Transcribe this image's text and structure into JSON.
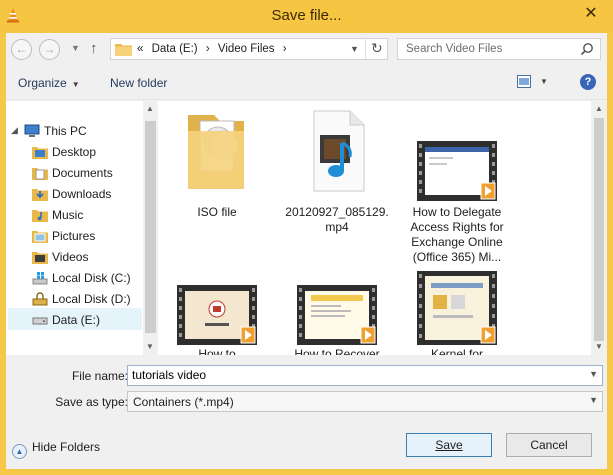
{
  "window": {
    "title": "Save file..."
  },
  "colors": {
    "accent_frame": "#f6c642",
    "selection": "#e5f3fb",
    "default_button_border": "#3c7fb1"
  },
  "nav": {
    "back_icon": "back-arrow-icon",
    "forward_icon": "forward-arrow-icon",
    "recent_icon": "chevron-down-icon",
    "up_icon": "up-arrow-icon",
    "breadcrumb_prefix": "«",
    "breadcrumbs": [
      "Data (E:)",
      "Video Files"
    ],
    "breadcrumb_sep": "›",
    "refresh_icon": "refresh-icon",
    "search_placeholder": "Search Video Files"
  },
  "toolbar": {
    "organize_label": "Organize",
    "new_folder_label": "New folder",
    "view_icon": "view-options-icon",
    "help_label": "?"
  },
  "sidebar": {
    "items": [
      {
        "label": "This PC",
        "icon": "computer-icon"
      },
      {
        "label": "Desktop",
        "icon": "desktop-folder-icon"
      },
      {
        "label": "Documents",
        "icon": "documents-folder-icon"
      },
      {
        "label": "Downloads",
        "icon": "downloads-folder-icon"
      },
      {
        "label": "Music",
        "icon": "music-folder-icon"
      },
      {
        "label": "Pictures",
        "icon": "pictures-folder-icon"
      },
      {
        "label": "Videos",
        "icon": "videos-folder-icon"
      },
      {
        "label": "Local Disk (C:)",
        "icon": "windows-drive-icon"
      },
      {
        "label": "Local Disk (D:)",
        "icon": "locked-drive-icon"
      },
      {
        "label": "Data (E:)",
        "icon": "drive-icon"
      }
    ],
    "selected_index": 9
  },
  "files": [
    {
      "name": "ISO file",
      "type": "folder"
    },
    {
      "name": "20120927_085129.\nmp4",
      "type": "media"
    },
    {
      "name": "How to Delegate\nAccess Rights for\nExchange Online\n(Office 365) Mi...",
      "type": "video"
    },
    {
      "name": "How to",
      "type": "video"
    },
    {
      "name": "How to Recover",
      "type": "video"
    },
    {
      "name": "Kernel for",
      "type": "video"
    }
  ],
  "form": {
    "file_name_label": "File name:",
    "file_name_value": "tutorials video",
    "save_as_type_label": "Save as type:",
    "save_as_type_value": "Containers (*.mp4)"
  },
  "footer": {
    "hide_folders_label": "Hide Folders",
    "save_label": "Save",
    "cancel_label": "Cancel"
  }
}
